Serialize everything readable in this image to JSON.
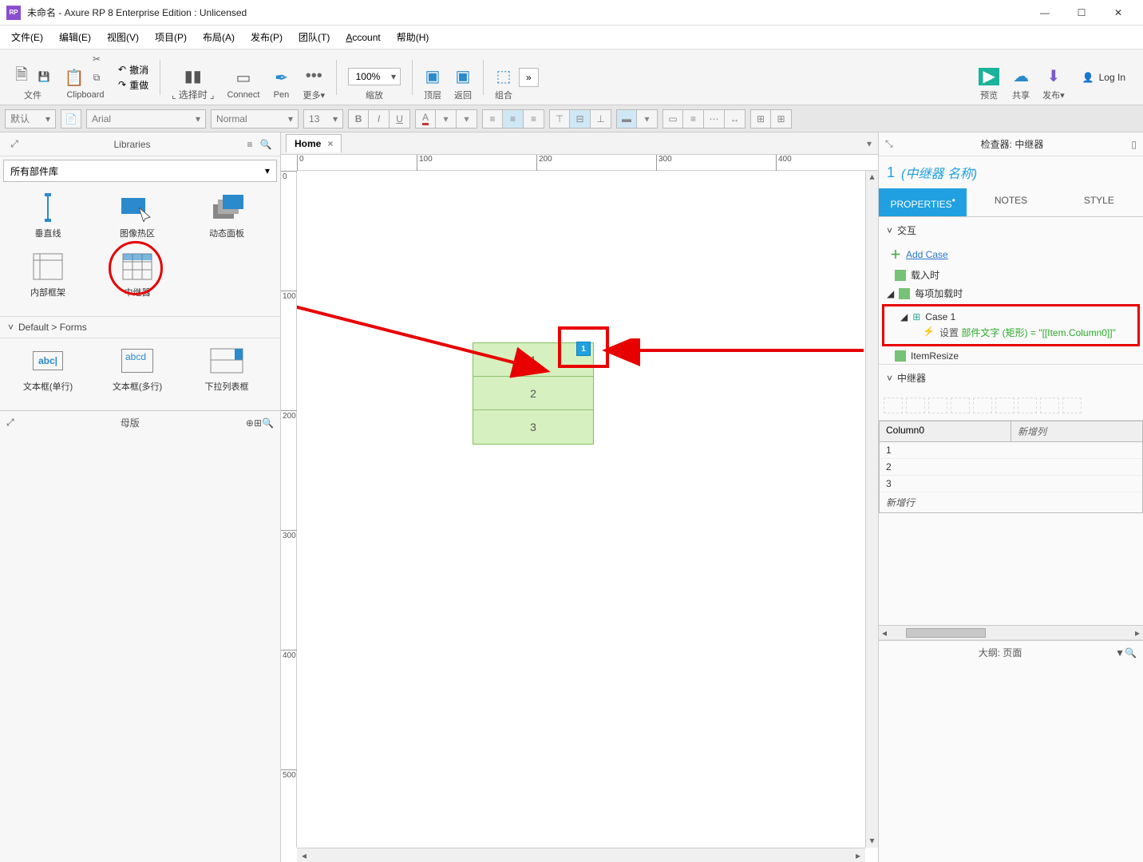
{
  "window": {
    "title": "未命名 - Axure RP 8 Enterprise Edition : Unlicensed",
    "logo": "RP"
  },
  "menus": [
    "文件(E)",
    "编辑(E)",
    "视图(V)",
    "项目(P)",
    "布局(A)",
    "发布(P)",
    "团队(T)",
    "Account",
    "帮助(H)"
  ],
  "toolbar": {
    "file": "文件",
    "clipboard": "Clipboard",
    "undo": "撤消",
    "redo": "重做",
    "select": "选择时",
    "connect": "Connect",
    "pen": "Pen",
    "more": "更多▾",
    "zoom_val": "100%",
    "zoom": "缩放",
    "top": "顶层",
    "back": "返回",
    "group": "组合",
    "preview": "预览",
    "share": "共享",
    "publish": "发布▾",
    "login": "Log In"
  },
  "formatbar": {
    "preset": "默认",
    "font": "Arial",
    "weight": "Normal",
    "size": "13"
  },
  "left": {
    "panel_title": "Libraries",
    "lib_dd": "所有部件库",
    "items1": [
      {
        "label": "垂直线"
      },
      {
        "label": "图像热区"
      },
      {
        "label": "动态面板"
      },
      {
        "label": "内部框架"
      },
      {
        "label": "中继器"
      }
    ],
    "section": "Default > Forms",
    "items2": [
      {
        "label": "文本框(单行)",
        "glyph": "abc|"
      },
      {
        "label": "文本框(多行)",
        "glyph": "abcd"
      },
      {
        "label": "下拉列表框"
      }
    ],
    "masters": "母版"
  },
  "tabs": {
    "home": "Home"
  },
  "ruler_h": [
    "0",
    "100",
    "200",
    "300",
    "400"
  ],
  "ruler_v": [
    "0",
    "100",
    "200",
    "300",
    "400",
    "500"
  ],
  "repeater_rows": [
    "1",
    "2",
    "3"
  ],
  "repeater_marker": "1",
  "right": {
    "title": "检查器: 中继器",
    "crumb_idx": "1",
    "crumb_name": "(中继器 名称)",
    "tabs": [
      "PROPERTIES",
      "NOTES",
      "STYLE"
    ],
    "sec_interact": "交互",
    "add_case": "Add Case",
    "ev_load": "载入时",
    "ev_itemload": "每项加载时",
    "case1": "Case 1",
    "action_prefix": "设置",
    "action_green": "部件文字 (矩形) = \"[[Item.Column0]]\"",
    "ev_resize": "ItemResize",
    "sec_repeater": "中继器",
    "table_hdr": [
      "Column0",
      "新增列"
    ],
    "table_rows": [
      "1",
      "2",
      "3"
    ],
    "table_addrow": "新增行",
    "outline_title": "大纲: 页面"
  }
}
